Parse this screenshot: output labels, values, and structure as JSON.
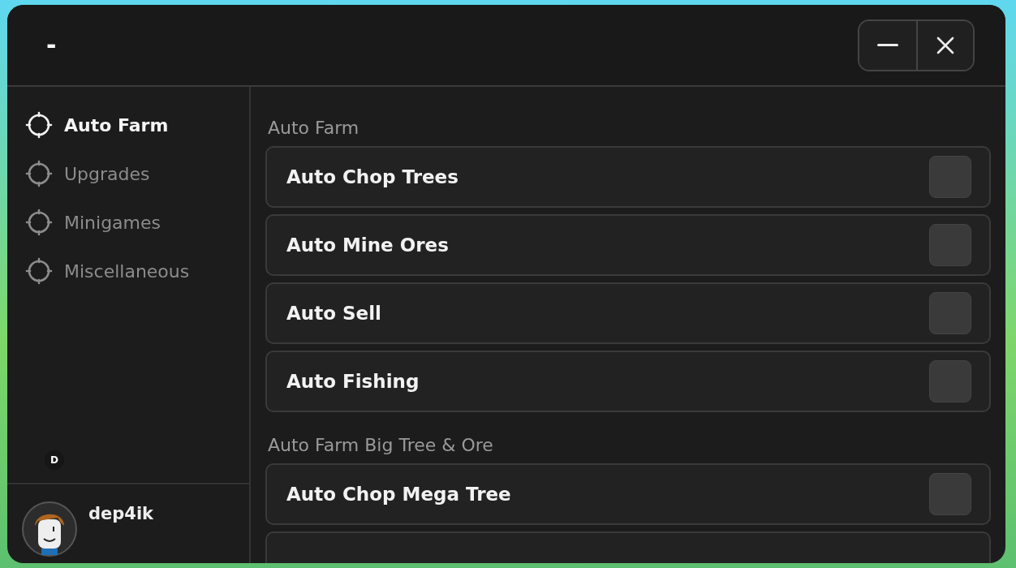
{
  "window": {
    "title": "-"
  },
  "sidebar": {
    "items": [
      {
        "label": "Auto Farm",
        "selected": true
      },
      {
        "label": "Upgrades",
        "selected": false
      },
      {
        "label": "Minigames",
        "selected": false
      },
      {
        "label": "Miscellaneous",
        "selected": false
      }
    ],
    "badge": "D",
    "user": {
      "name": "dep4ik"
    }
  },
  "sections": [
    {
      "title": "Auto Farm",
      "toggles": [
        {
          "label": "Auto Chop Trees",
          "checked": false
        },
        {
          "label": "Auto Mine Ores",
          "checked": false
        },
        {
          "label": "Auto Sell",
          "checked": false
        },
        {
          "label": "Auto Fishing",
          "checked": false
        }
      ]
    },
    {
      "title": "Auto Farm Big Tree & Ore",
      "toggles": [
        {
          "label": "Auto Chop Mega Tree",
          "checked": false
        }
      ]
    }
  ]
}
